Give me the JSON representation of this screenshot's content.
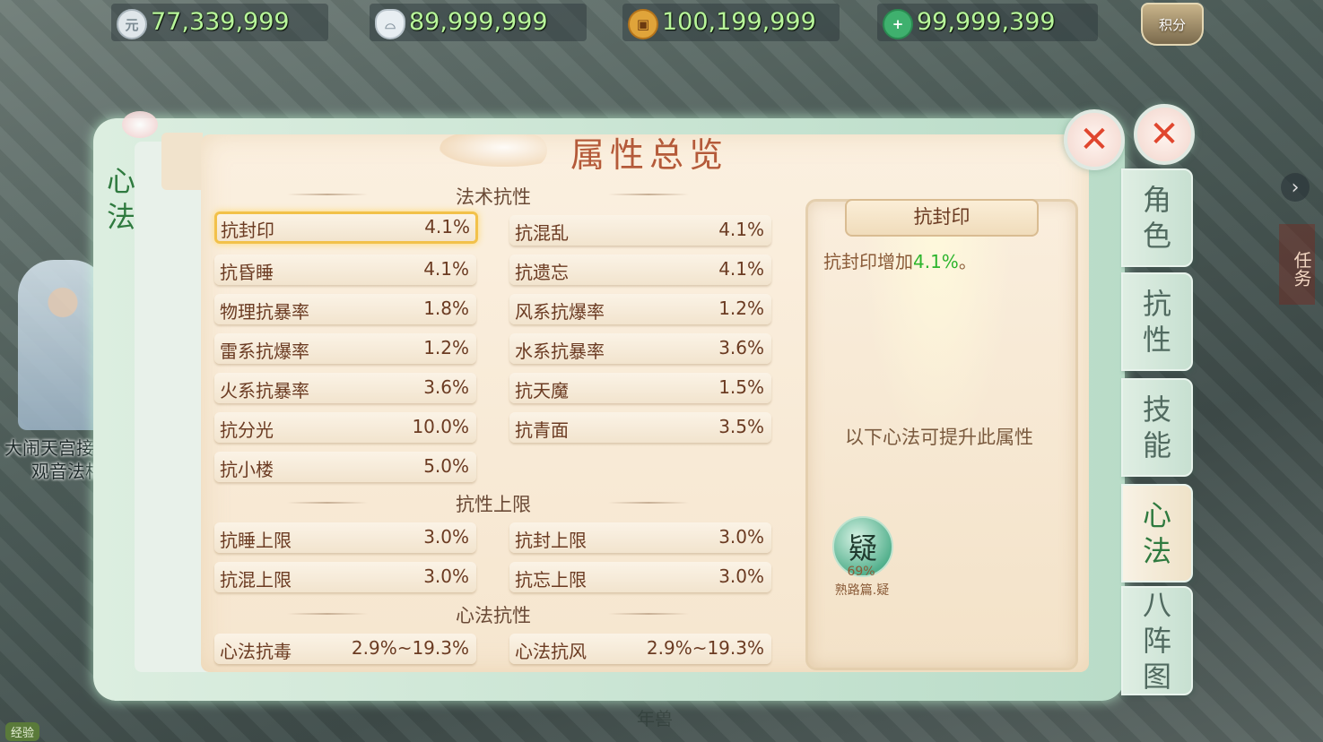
{
  "currencies": [
    {
      "icon": "silver-coin-icon",
      "value": "77,339,999"
    },
    {
      "icon": "silver-ingot-icon",
      "value": "89,999,999"
    },
    {
      "icon": "copper-coin-icon",
      "value": "100,199,999"
    },
    {
      "icon": "jade-plus-icon",
      "value": "99,999,399"
    }
  ],
  "score_button": "积分",
  "left_tab": "心法",
  "title": "属性总览",
  "sections": {
    "magic_resist": {
      "title": "法术抗性",
      "items": [
        {
          "label": "抗封印",
          "value": "4.1%"
        },
        {
          "label": "抗混乱",
          "value": "4.1%"
        },
        {
          "label": "抗昏睡",
          "value": "4.1%"
        },
        {
          "label": "抗遗忘",
          "value": "4.1%"
        },
        {
          "label": "物理抗暴率",
          "value": "1.8%"
        },
        {
          "label": "风系抗爆率",
          "value": "1.2%"
        },
        {
          "label": "雷系抗爆率",
          "value": "1.2%"
        },
        {
          "label": "水系抗暴率",
          "value": "3.6%"
        },
        {
          "label": "火系抗暴率",
          "value": "3.6%"
        },
        {
          "label": "抗天魔",
          "value": "1.5%"
        },
        {
          "label": "抗分光",
          "value": "10.0%"
        },
        {
          "label": "抗青面",
          "value": "3.5%"
        },
        {
          "label": "抗小楼",
          "value": "5.0%"
        }
      ]
    },
    "resist_cap": {
      "title": "抗性上限",
      "items": [
        {
          "label": "抗睡上限",
          "value": "3.0%"
        },
        {
          "label": "抗封上限",
          "value": "3.0%"
        },
        {
          "label": "抗混上限",
          "value": "3.0%"
        },
        {
          "label": "抗忘上限",
          "value": "3.0%"
        }
      ]
    },
    "xinfa_resist": {
      "title": "心法抗性",
      "items": [
        {
          "label": "心法抗毒",
          "value": "2.9%~19.3%"
        },
        {
          "label": "心法抗风",
          "value": "2.9%~19.3%"
        }
      ]
    }
  },
  "detail": {
    "header": "抗封印",
    "desc_prefix": "抗封印增加",
    "desc_value": "4.1%",
    "desc_suffix": "。",
    "tip": "以下心法可提升此属性",
    "skill": {
      "glyph": "疑",
      "percent": "69%",
      "name": "熟路篇.疑"
    }
  },
  "right_tabs": [
    {
      "label": "角色",
      "active": false
    },
    {
      "label": "抗性",
      "active": false
    },
    {
      "label": "技能",
      "active": false
    },
    {
      "label": "心法",
      "active": true
    },
    {
      "label": "八阵图",
      "active": false
    }
  ],
  "background": {
    "npc_label_line1": "大闹天宫接引人",
    "npc_label_line2": "观音法相",
    "bottom_label": "年兽",
    "exp_label": "经验",
    "task_tag": "任务"
  }
}
